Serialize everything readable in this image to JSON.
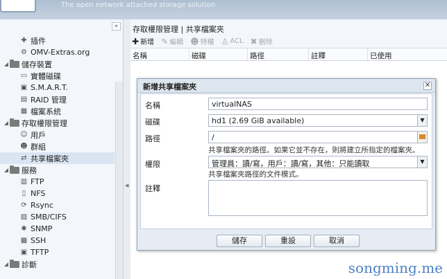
{
  "banner": {
    "tagline": "The open network attached storage solution"
  },
  "sidebar": {
    "collapse_icon": "«",
    "items": [
      {
        "label": "插件",
        "icon": "puzzle-icon",
        "level": 1
      },
      {
        "label": "OMV-Extras.org",
        "icon": "gear-icon",
        "level": 1
      },
      {
        "label": "儲存裝置",
        "icon": "folder-icon",
        "level": 0
      },
      {
        "label": "實體磁碟",
        "icon": "disk-icon",
        "level": 1
      },
      {
        "label": "S.M.A.R.T.",
        "icon": "smart-icon",
        "level": 1
      },
      {
        "label": "RAID 管理",
        "icon": "raid-icon",
        "level": 1
      },
      {
        "label": "檔案系統",
        "icon": "filesystem-icon",
        "level": 1
      },
      {
        "label": "存取權限管理",
        "icon": "folder-icon",
        "level": 0
      },
      {
        "label": "用戶",
        "icon": "user-icon",
        "level": 1
      },
      {
        "label": "群組",
        "icon": "group-icon",
        "level": 1
      },
      {
        "label": "共享檔案夾",
        "icon": "share-icon",
        "level": 1
      },
      {
        "label": "服務",
        "icon": "folder-icon",
        "level": 0
      },
      {
        "label": "FTP",
        "icon": "ftp-icon",
        "level": 1
      },
      {
        "label": "NFS",
        "icon": "nfs-icon",
        "level": 1
      },
      {
        "label": "Rsync",
        "icon": "rsync-icon",
        "level": 1
      },
      {
        "label": "SMB/CIFS",
        "icon": "smb-icon",
        "level": 1
      },
      {
        "label": "SNMP",
        "icon": "snmp-icon",
        "level": 1
      },
      {
        "label": "SSH",
        "icon": "ssh-icon",
        "level": 1
      },
      {
        "label": "TFTP",
        "icon": "tftp-icon",
        "level": 1
      },
      {
        "label": "診斷",
        "icon": "folder-icon",
        "level": 0
      }
    ]
  },
  "main": {
    "breadcrumb": "存取權限管理 | 共享檔案夾",
    "toolbar": {
      "add": "新增",
      "edit": "編輯",
      "privileges": "特權",
      "acl": "ACL",
      "delete": "刪除"
    },
    "columns": [
      "名稱",
      "磁碟",
      "路徑",
      "註釋",
      "已使用"
    ]
  },
  "dialog": {
    "title": "新增共享檔案夾",
    "name_label": "名稱",
    "name_value": "virtualNAS",
    "device_label": "磁碟",
    "device_value": "hd1 (2.69 GiB available)",
    "path_label": "路徑",
    "path_value": "/",
    "path_hint": "共享檔案夾的路徑。如果它並不存在，則將建立所指定的檔案夾。",
    "permissions_label": "權限",
    "permissions_value": "管理員：讀/寫，用戶：讀/寫，其他：只能讀取",
    "permissions_hint": "共享檔案夾路徑的文件模式。",
    "comment_label": "註釋",
    "save": "儲存",
    "reset": "重設",
    "cancel": "取消"
  },
  "watermark": "songming.me",
  "colors": {
    "accent": "#4c7fc4",
    "panel": "#f3f6fa",
    "banner": "#aebfd2"
  }
}
